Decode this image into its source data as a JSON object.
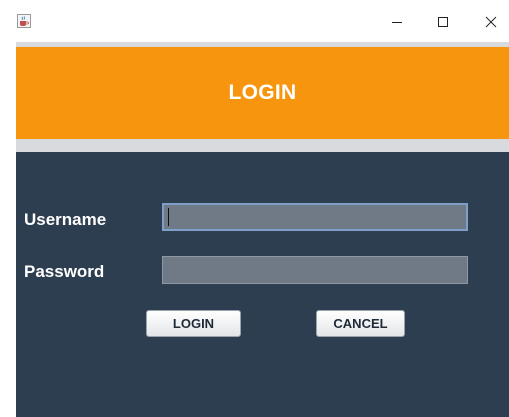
{
  "window": {
    "icon": "java-cup-icon",
    "controls": {
      "minimize": "minimize-icon",
      "maximize": "maximize-icon",
      "close": "close-icon"
    }
  },
  "header": {
    "title": "LOGIN",
    "background": "#f7950f"
  },
  "form": {
    "background": "#2c3e50",
    "username_label": "Username",
    "username_value": "",
    "password_label": "Password",
    "password_value": ""
  },
  "buttons": {
    "login_label": "LOGIN",
    "cancel_label": "CANCEL"
  }
}
